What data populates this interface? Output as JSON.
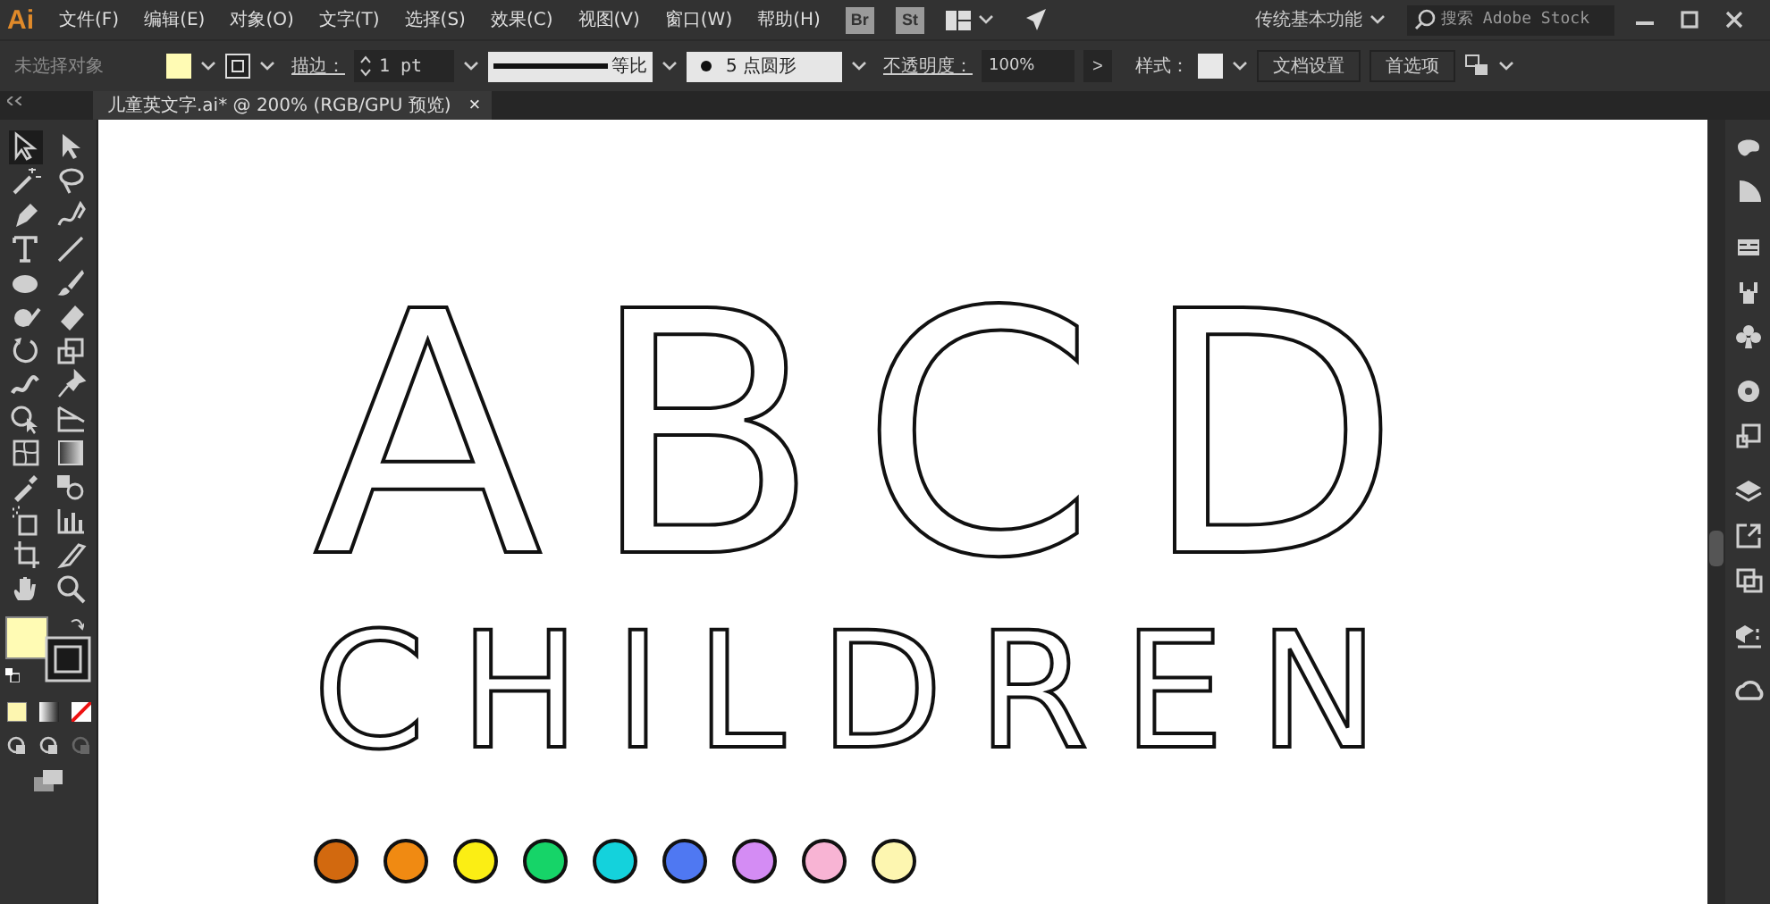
{
  "app_logo": "Ai",
  "menu": [
    "文件(F)",
    "编辑(E)",
    "对象(O)",
    "文字(T)",
    "选择(S)",
    "效果(C)",
    "视图(V)",
    "窗口(W)",
    "帮助(H)"
  ],
  "bridge_buttons": [
    "Br",
    "St"
  ],
  "workspace": "传统基本功能",
  "search": {
    "placeholder": "搜索 Adobe Stock"
  },
  "control_bar": {
    "selection": "未选择对象",
    "stroke_label": "描边：",
    "stroke_weight": "1 pt",
    "stroke_profile": "等比",
    "brush": "5 点圆形",
    "opacity_label": "不透明度：",
    "opacity": "100%",
    "more": ">",
    "style_label": "样式：",
    "buttons": [
      "文档设置",
      "首选项"
    ]
  },
  "document_tab": {
    "title": "儿童英文字.ai* @ 200% (RGB/GPU 预览)",
    "close": "×"
  },
  "artboard": {
    "lines": [
      "ABCD",
      "CHILDREN"
    ],
    "swatches": [
      {
        "color": "#d2690f"
      },
      {
        "color": "#f08a12"
      },
      {
        "color": "#fbee14"
      },
      {
        "color": "#16d468"
      },
      {
        "color": "#14d2dc"
      },
      {
        "color": "#4f78f2"
      },
      {
        "color": "#d48cf4"
      },
      {
        "color": "#f8b4d4"
      },
      {
        "color": "#fdf6b0"
      }
    ]
  }
}
